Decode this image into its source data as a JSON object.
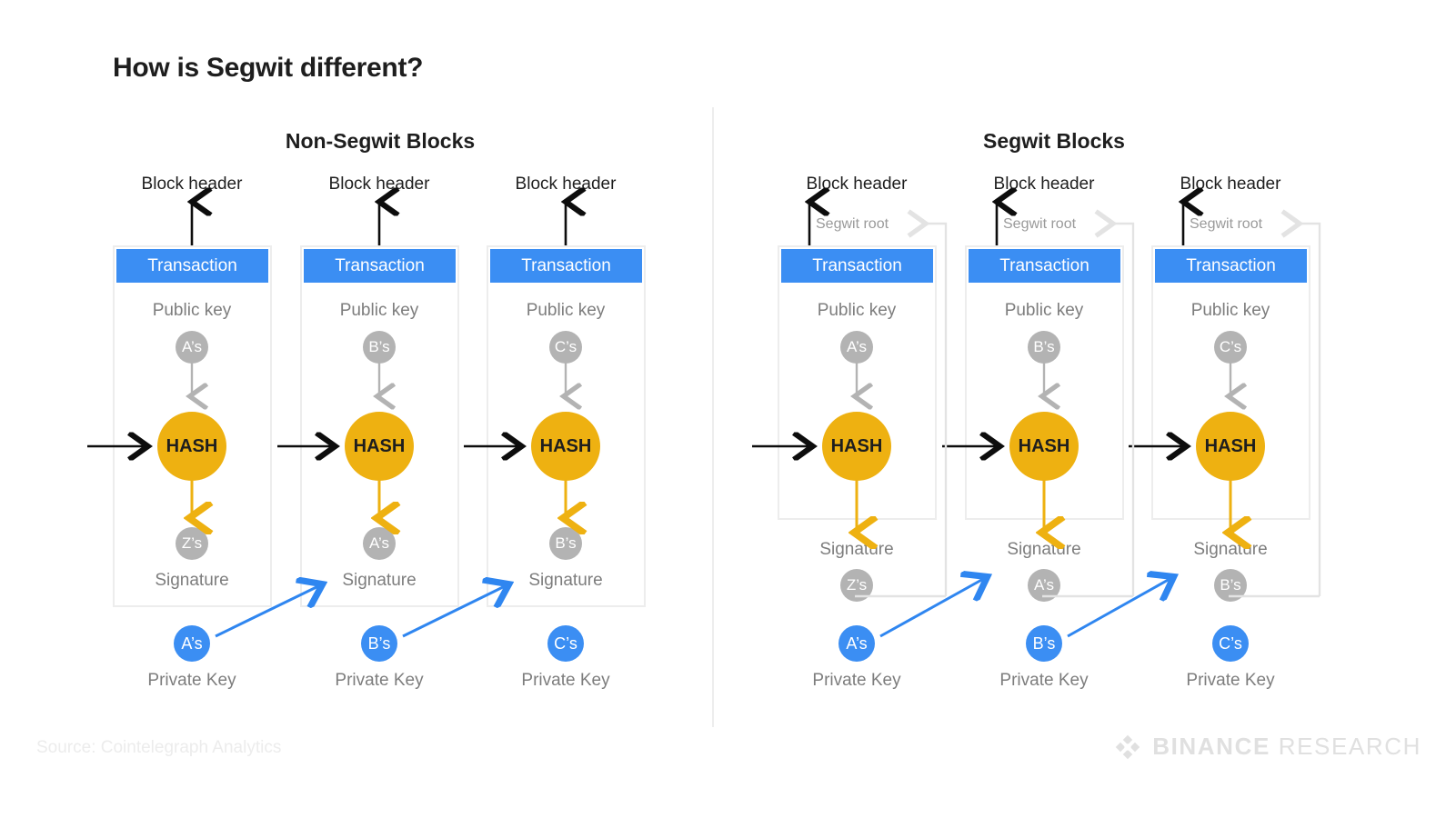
{
  "title": "How is Segwit different?",
  "panels": [
    {
      "id": "non-segwit",
      "title": "Non-Segwit Blocks"
    },
    {
      "id": "segwit",
      "title": "Segwit Blocks"
    }
  ],
  "labels": {
    "block_header": "Block header",
    "transaction": "Transaction",
    "public_key": "Public key",
    "signature": "Signature",
    "private_key": "Private Key",
    "hash": "HASH",
    "segwit_root": "Segwit root"
  },
  "non_segwit_blocks": [
    {
      "public_key": "A’s",
      "signature": "Z’s",
      "private_key": "A’s"
    },
    {
      "public_key": "B’s",
      "signature": "A’s",
      "private_key": "B’s"
    },
    {
      "public_key": "C’s",
      "signature": "B’s",
      "private_key": "C’s"
    }
  ],
  "segwit_blocks": [
    {
      "public_key": "A’s",
      "signature": "Z’s",
      "private_key": "A’s"
    },
    {
      "public_key": "B’s",
      "signature": "A’s",
      "private_key": "B’s"
    },
    {
      "public_key": "C’s",
      "signature": "B’s",
      "private_key": "C’s"
    }
  ],
  "footer": {
    "source": "Source: Cointelegraph Analytics",
    "brand_bold": "BINANCE",
    "brand_light": "RESEARCH"
  },
  "colors": {
    "accent_blue": "#3b8ef3",
    "hash_yellow": "#eeb111",
    "gray": "#b3b3b3",
    "text_gray": "#7d7d7d",
    "box_border": "#ededed",
    "title": "#1e1e1e"
  }
}
